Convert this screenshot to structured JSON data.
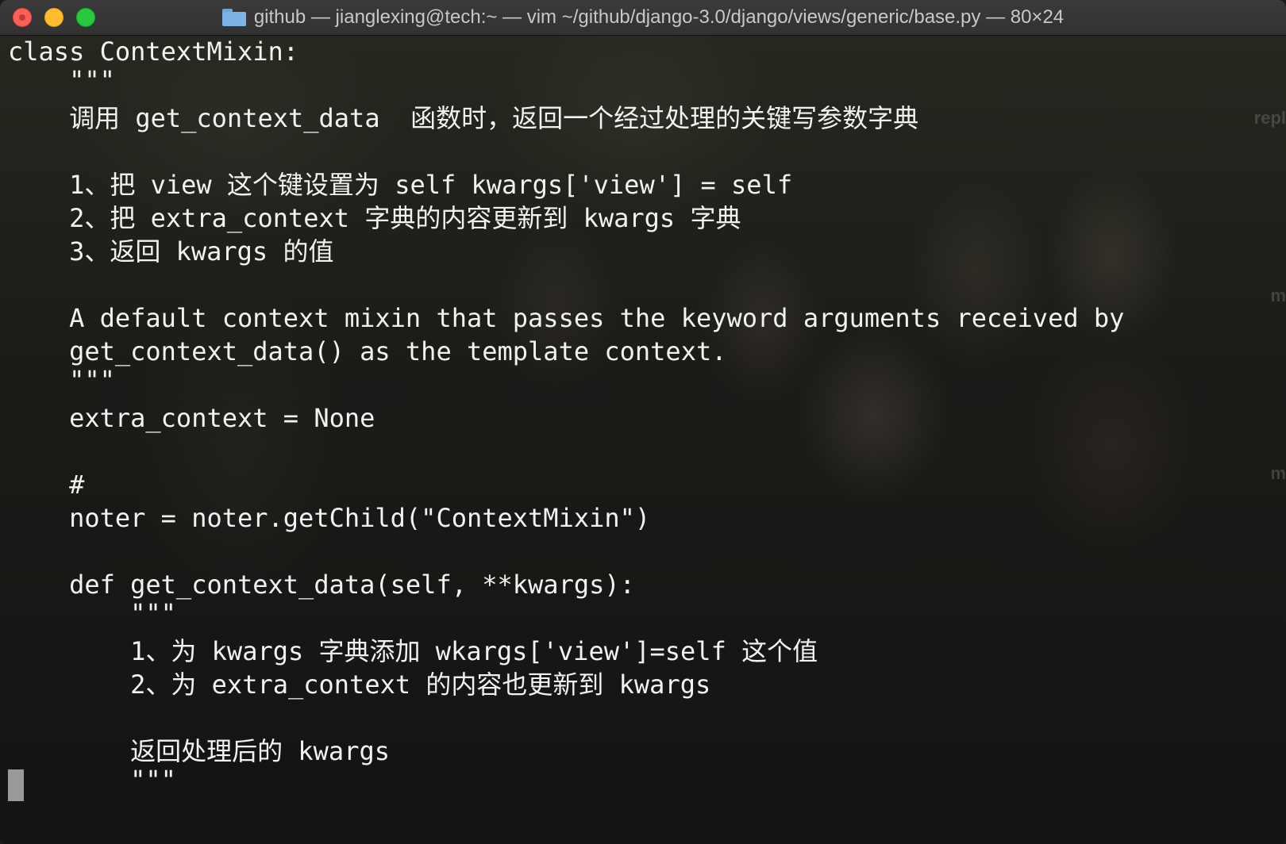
{
  "window": {
    "title": "github — jianglexing@tech:~ — vim ~/github/django-3.0/django/views/generic/base.py — 80×24"
  },
  "side_labels": [
    "repl",
    "m",
    "m"
  ],
  "editor": {
    "lines": [
      "class ContextMixin:",
      "    \"\"\"",
      "    调用 get_context_data  函数时，返回一个经过处理的关键写参数字典",
      "",
      "    1、把 view 这个键设置为 self kwargs['view'] = self",
      "    2、把 extra_context 字典的内容更新到 kwargs 字典",
      "    3、返回 kwargs 的值",
      "",
      "    A default context mixin that passes the keyword arguments received by",
      "    get_context_data() as the template context.",
      "    \"\"\"",
      "    extra_context = None",
      "",
      "    #",
      "    noter = noter.getChild(\"ContextMixin\")",
      "",
      "    def get_context_data(self, **kwargs):",
      "        \"\"\"",
      "        1、为 kwargs 字典添加 wkargs['view']=self 这个值",
      "        2、为 extra_context 的内容也更新到 kwargs",
      "",
      "        返回处理后的 kwargs",
      "        \"\"\""
    ]
  }
}
